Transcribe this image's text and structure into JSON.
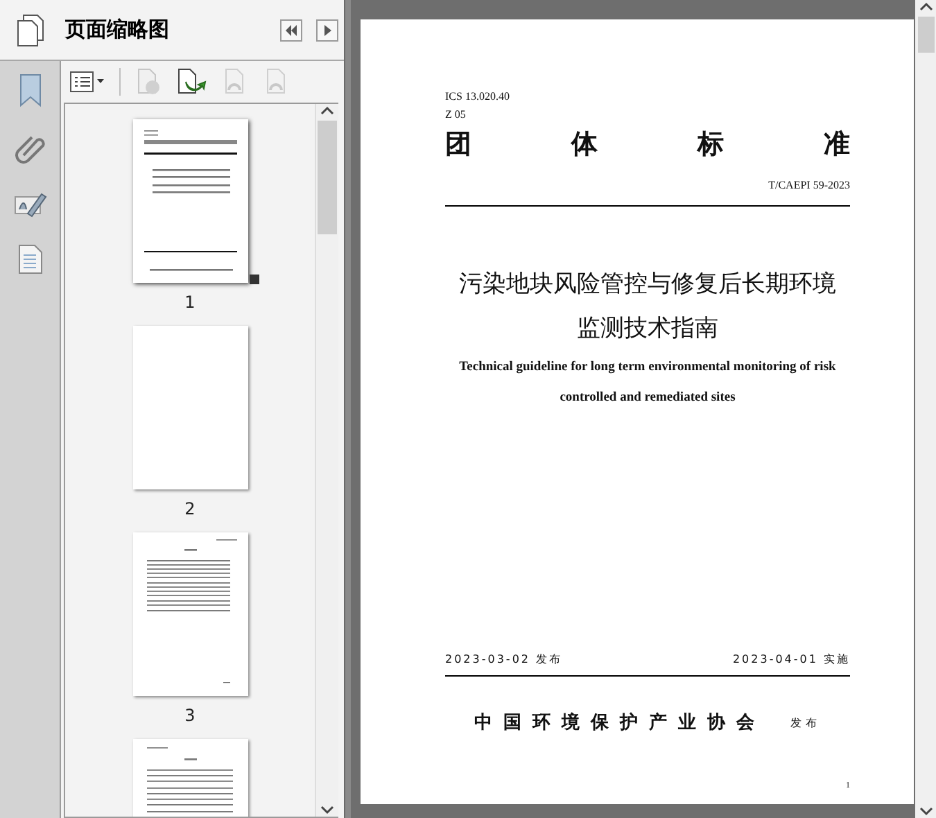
{
  "panel": {
    "title": "页面缩略图"
  },
  "thumbnails": [
    {
      "label": "1",
      "selected": true,
      "kind": "cover"
    },
    {
      "label": "2",
      "selected": false,
      "kind": "blank"
    },
    {
      "label": "3",
      "selected": false,
      "kind": "contents"
    },
    {
      "selected": false,
      "kind": "text"
    }
  ],
  "document": {
    "ics": "ICS 13.020.40",
    "code": "Z 05",
    "heading": [
      "团",
      "体",
      "标",
      "准"
    ],
    "number": "T/CAEPI 59-2023",
    "title_lines": [
      "污染地块风险管控与修复后长期环境",
      "监测技术指南"
    ],
    "english_lines": [
      "Technical guideline for long term environmental monitoring of risk",
      "controlled and remediated sites"
    ],
    "issue_date": "2023-03-02 发布",
    "effective_date": "2023-04-01 实施",
    "publisher": "中国环境保护产业协会",
    "publisher_note": "发布",
    "page_number": "1"
  }
}
